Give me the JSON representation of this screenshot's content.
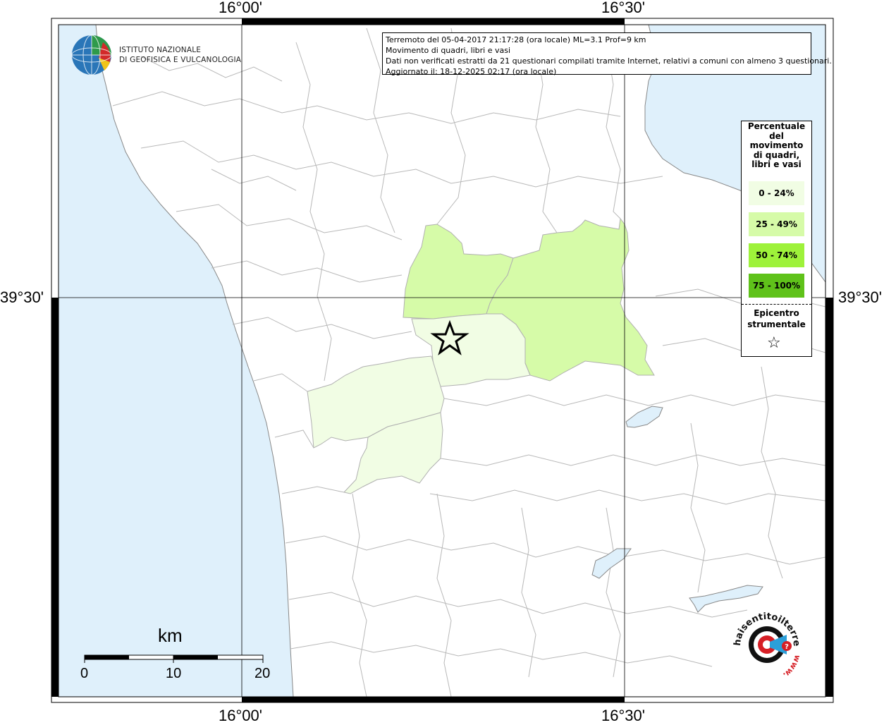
{
  "axes": {
    "top_labels": [
      "16°00'",
      "16°30'"
    ],
    "bottom_labels": [
      "16°00'",
      "16°30'"
    ],
    "left_label": "39°30'",
    "right_label": "39°30'"
  },
  "info_box": {
    "line1": "Terremoto del 05-04-2017 21:17:28 (ora locale) ML=3.1 Prof=9 km",
    "line2": "Movimento di quadri, libri e vasi",
    "line3": "Dati non verificati estratti da 21 questionari compilati tramite Internet, relativi a comuni con almeno 3 questionari.",
    "line4": "Aggiornato il: 18-12-2025 02:17 (ora locale)"
  },
  "legend": {
    "title_lines": [
      "Percentuale",
      "del",
      "movimento",
      "di quadri,",
      "libri e vasi"
    ],
    "classes": [
      {
        "label": "0 - 24%",
        "color": "#f1fde4"
      },
      {
        "label": "25 - 49%",
        "color": "#d6fba8"
      },
      {
        "label": "50 - 74%",
        "color": "#9ef23a"
      },
      {
        "label": "75 - 100%",
        "color": "#5fc21a"
      }
    ],
    "epicenter_lines": [
      "Epicentro",
      "strumentale"
    ],
    "epicenter_symbol": "☆"
  },
  "ingv_logo": {
    "line1": "ISTITUTO NAZIONALE",
    "line2": "DI GEOFISICA E VULCANOLOGIA"
  },
  "scale_bar": {
    "unit": "km",
    "labels": [
      "0",
      "10",
      "20"
    ]
  },
  "haisentito_logo": {
    "text": "haisentitoilterremoto.it",
    "prefix": "www."
  },
  "colors": {
    "sea": "#dff0fb",
    "land": "#ffffff",
    "boundary": "#b8b8b8",
    "low_class": "#f1fde4",
    "mid_class": "#d6fba8"
  },
  "municipality_classes": {
    "north_central": "25 - 49%",
    "east": "25 - 49%",
    "epicenter_area": "0 - 24%",
    "southwest": "0 - 24%",
    "south": "0 - 24%"
  }
}
